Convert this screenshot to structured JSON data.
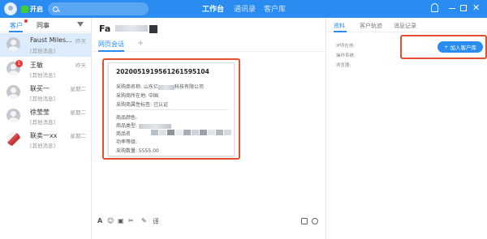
{
  "topbar": {
    "status_label": "开启",
    "nav": [
      "工作台",
      "通讯录",
      "客户库"
    ],
    "colors": {
      "bar": "#2a8cf0",
      "status": "#47c93b"
    }
  },
  "left": {
    "tabs": [
      "客户",
      "同事"
    ],
    "contacts": [
      {
        "name": "Faust Miles...",
        "sub": "[其他消息]",
        "time": "昨天",
        "selected": true
      },
      {
        "name": "王敏",
        "sub": "[其他消息]",
        "time": "昨天",
        "badge": "1"
      },
      {
        "name": "联买一",
        "sub": "[其他消息]",
        "time": "星期二"
      },
      {
        "name": "徐莹莹",
        "sub": "[其他消息]",
        "time": "星期二"
      },
      {
        "name": "联卖一xx",
        "sub": "[其他消息]",
        "time": "星期二"
      }
    ]
  },
  "middle": {
    "title": "Fa",
    "tab": "网页会话",
    "order": {
      "number": "202005191956126159510​4",
      "lines": [
        {
          "label": "采购商名称:",
          "prefix": "山东亿",
          "suffix": "科技有限公司"
        },
        {
          "label": "采购商所在地:",
          "prefix": "中国",
          "suffix": ""
        },
        {
          "label": "采购商属性标签:",
          "prefix": "已认证",
          "suffix": ""
        }
      ],
      "goods_lines": [
        {
          "label": "商品颜色:"
        },
        {
          "label": "商品类型:"
        },
        {
          "label": "商品名"
        },
        {
          "label": "功率等级:"
        }
      ],
      "quantity": "采购数量: 5555.00"
    },
    "toolbar": {
      "items": [
        "A",
        "☺",
        "▣",
        "✂",
        "✎",
        "译"
      ]
    }
  },
  "right": {
    "tabs": [
      "资料",
      "客户轨迹",
      "消息记录"
    ],
    "info": [
      "IP所在地:",
      "操作系统:",
      "浏览器:"
    ],
    "join_button": "加入客户库"
  }
}
